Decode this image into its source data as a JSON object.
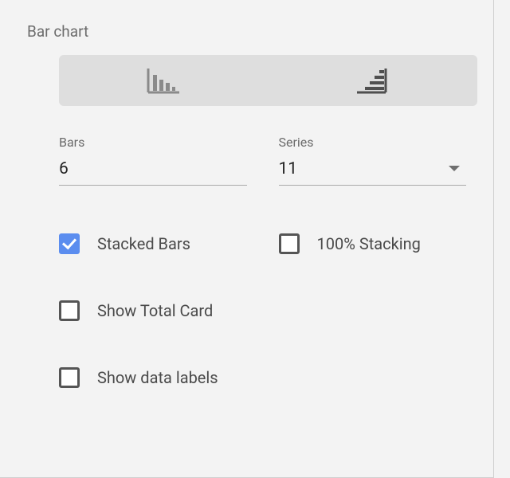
{
  "panel": {
    "title": "Bar chart",
    "orientation": {
      "vertical_icon": "vertical-bars-icon",
      "horizontal_icon": "horizontal-bars-icon"
    },
    "fields": {
      "bars": {
        "label": "Bars",
        "value": "6"
      },
      "series": {
        "label": "Series",
        "value": "11"
      }
    },
    "checks": {
      "stacked": {
        "label": "Stacked Bars",
        "checked": true
      },
      "stacking100": {
        "label": "100% Stacking",
        "checked": false
      },
      "total_card": {
        "label": "Show Total Card",
        "checked": false
      },
      "data_labels": {
        "label": "Show data labels",
        "checked": false
      }
    }
  }
}
